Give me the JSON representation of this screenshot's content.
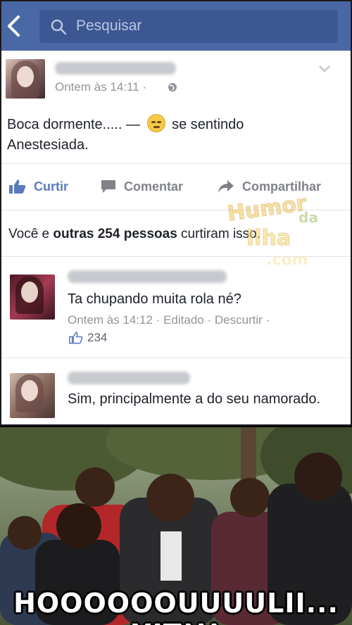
{
  "search": {
    "placeholder": "Pesquisar"
  },
  "post": {
    "time": "Ontem às 14:11 ·",
    "text_main": "Boca dormente..... —",
    "feeling_text": "se sentindo",
    "feeling_value": "Anestesiada.",
    "actions": {
      "like": "Curtir",
      "comment": "Comentar",
      "share": "Compartilhar"
    },
    "likes_prefix": "Você e",
    "likes_bold": "outras 254 pessoas",
    "likes_suffix": "curtiram isso."
  },
  "watermark": {
    "line1": "Humor",
    "line2": "da",
    "line3": "Ilha",
    "line4": ".com"
  },
  "comments": [
    {
      "text": "Ta chupando muita rola né?",
      "meta": "Ontem às 14:12 · Editado · Descurtir ·",
      "likes": "234"
    },
    {
      "text": "Sim, principalmente a do seu namorado."
    }
  ],
  "meme": {
    "caption": "HOOOOOOUUUULII... XIT!!!"
  },
  "colors": {
    "fb_blue": "#4b68a6",
    "like_blue": "#5b7bbf"
  }
}
